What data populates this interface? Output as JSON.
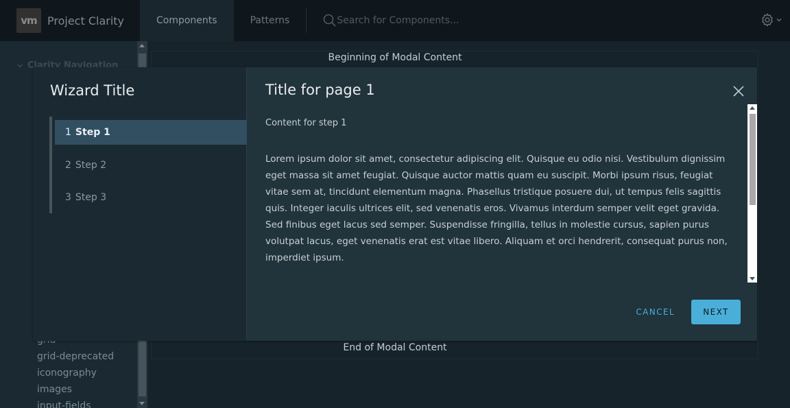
{
  "header": {
    "logo_text": "vm",
    "brand_title": "Project Clarity",
    "nav": [
      {
        "label": "Components",
        "active": true
      },
      {
        "label": "Patterns",
        "active": false
      }
    ],
    "search": {
      "placeholder": "Search for Components...",
      "value": ""
    },
    "settings_icon": "gear-icon"
  },
  "sidebar": {
    "section_label": "Clarity Navigation",
    "items": [
      "grid",
      "grid-deprecated",
      "iconography",
      "images",
      "input-fields"
    ]
  },
  "background": {
    "begin_text": "Beginning of Modal Content",
    "end_text": "End of Modal Content"
  },
  "wizard": {
    "title": "Wizard Title",
    "steps": [
      {
        "num": "1",
        "label": "Step 1",
        "active": true
      },
      {
        "num": "2",
        "label": "Step 2",
        "active": false
      },
      {
        "num": "3",
        "label": "Step 3",
        "active": false
      }
    ],
    "page_title": "Title for page 1",
    "step_content": "Content for step 1",
    "body_text": "Lorem ipsum dolor sit amet, consectetur adipiscing elit. Quisque eu odio nisi. Vestibulum dignissim eget massa sit amet feugiat. Quisque auctor mattis quam eu suscipit. Morbi ipsum risus, feugiat vitae sem at, tincidunt elementum magna. Phasellus tristique posuere dui, ut tempus felis sagittis quis. Integer iaculis ultrices elit, sed venenatis eros. Vivamus interdum semper velit eget gravida. Sed finibus eget lacus sed semper. Suspendisse fringilla, tellus in molestie cursus, sapien purus volutpat lacus, eget venenatis erat est vitae libero. Aliquam et orci hendrerit, consequat purus non, imperdiet ipsum.",
    "cancel_label": "CANCEL",
    "next_label": "NEXT"
  },
  "colors": {
    "accent": "#49afd9",
    "active_step": "#324f62",
    "modal_main": "#21333b",
    "modal_nav": "#1b2a32",
    "header": "#0f171c"
  }
}
